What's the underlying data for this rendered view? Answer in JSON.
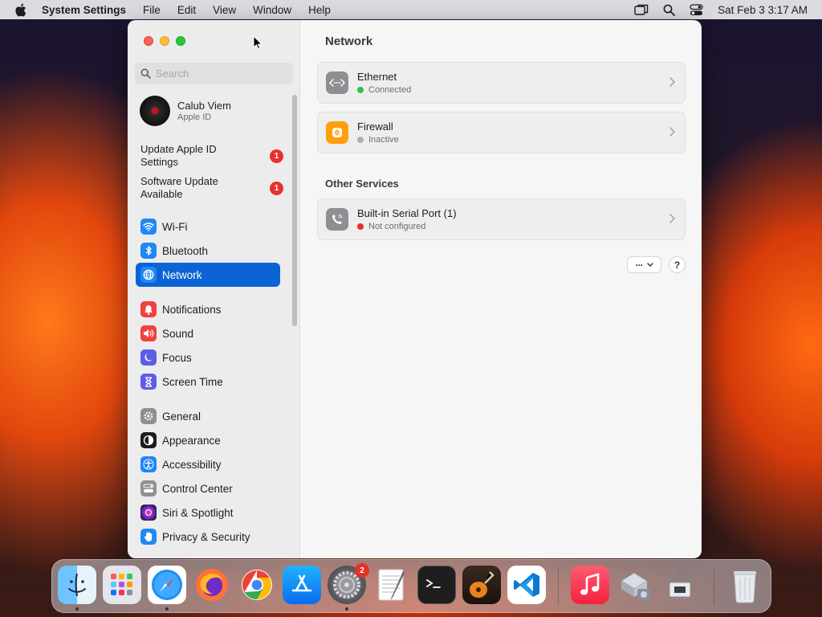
{
  "menubar": {
    "app_name": "System Settings",
    "items": [
      "File",
      "Edit",
      "View",
      "Window",
      "Help"
    ],
    "datetime": "Sat Feb 3  3:17 AM"
  },
  "sidebar": {
    "search_placeholder": "Search",
    "account": {
      "name": "Calub Viem",
      "subtitle": "Apple ID"
    },
    "notices": [
      {
        "label": "Update Apple ID Settings",
        "badge": "1"
      },
      {
        "label": "Software Update Available",
        "badge": "1"
      }
    ],
    "items": [
      {
        "label": "Wi-Fi",
        "icon": "wifi-icon",
        "color": "#1e88f5"
      },
      {
        "label": "Bluetooth",
        "icon": "bluetooth-icon",
        "color": "#1e88f5"
      },
      {
        "label": "Network",
        "icon": "globe-icon",
        "color": "#1e88f5",
        "selected": true
      },
      {
        "label": "Notifications",
        "icon": "bell-icon",
        "color": "#f0413c"
      },
      {
        "label": "Sound",
        "icon": "speaker-icon",
        "color": "#f0413c"
      },
      {
        "label": "Focus",
        "icon": "moon-icon",
        "color": "#5e5ce6"
      },
      {
        "label": "Screen Time",
        "icon": "hourglass-icon",
        "color": "#5e5ce6"
      },
      {
        "label": "General",
        "icon": "gear-icon",
        "color": "#8e8e93"
      },
      {
        "label": "Appearance",
        "icon": "appearance-icon",
        "color": "#1d1d1f"
      },
      {
        "label": "Accessibility",
        "icon": "accessibility-icon",
        "color": "#1e88f5"
      },
      {
        "label": "Control Center",
        "icon": "control-center-icon",
        "color": "#8e8e93"
      },
      {
        "label": "Siri & Spotlight",
        "icon": "siri-icon",
        "color": "#b13bd6"
      },
      {
        "label": "Privacy & Security",
        "icon": "hand-icon",
        "color": "#1e88f5"
      }
    ]
  },
  "content": {
    "title": "Network",
    "services": [
      {
        "name": "Ethernet",
        "status": "Connected",
        "status_color": "#30c048",
        "icon": "ethernet-icon"
      },
      {
        "name": "Firewall",
        "status": "Inactive",
        "status_color": "#b0b0b0",
        "icon": "firewall-icon"
      }
    ],
    "other_title": "Other Services",
    "other_services": [
      {
        "name": "Built-in Serial Port (1)",
        "status": "Not configured",
        "status_color": "#e8302b",
        "icon": "phone-icon"
      }
    ],
    "more_label": "···",
    "help_label": "?"
  },
  "dock": {
    "apps": [
      "Finder",
      "Launchpad",
      "Safari",
      "Firefox",
      "Chrome",
      "App Store",
      "System Settings",
      "TextEdit",
      "Terminal",
      "GarageBand",
      "Visual Studio Code",
      "Music",
      "Migration Assistant",
      "System Information",
      "Trash"
    ],
    "settings_badge": "2"
  }
}
